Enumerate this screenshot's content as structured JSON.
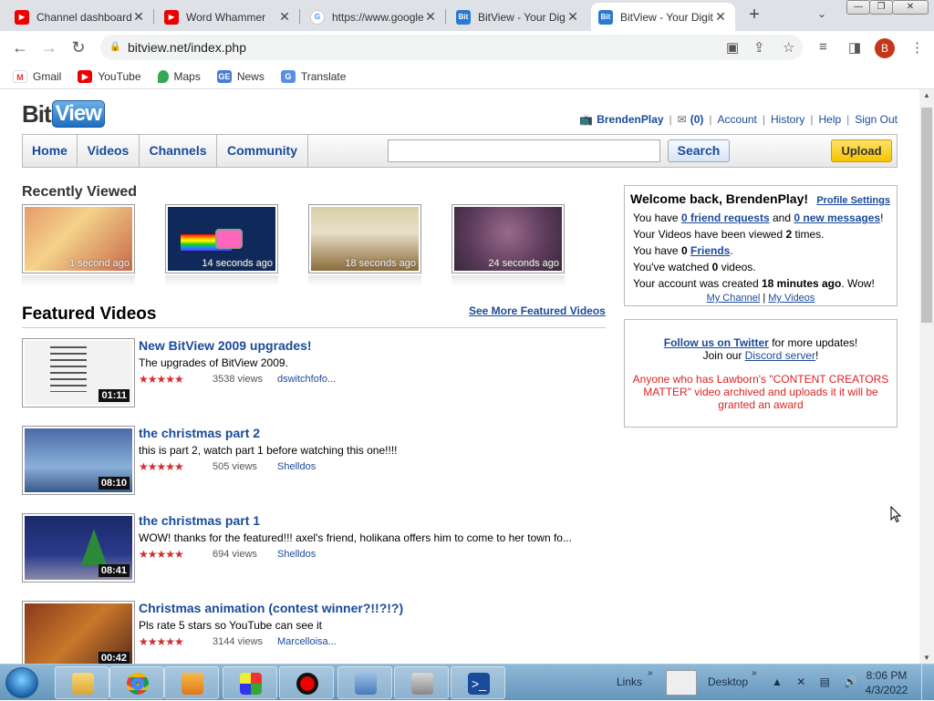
{
  "browser": {
    "tabs": [
      {
        "title": "Channel dashboard",
        "icon": "youtube-icon"
      },
      {
        "title": "Word Whammer",
        "icon": "youtube-icon"
      },
      {
        "title": "https://www.google",
        "icon": "google-icon"
      },
      {
        "title": "BitView - Your Digital",
        "icon": "bitview-icon"
      },
      {
        "title": "BitView - Your Digital",
        "icon": "bitview-icon"
      }
    ],
    "url": "bitview.net/index.php",
    "profile_initial": "B",
    "bookmarks": [
      {
        "label": "Gmail"
      },
      {
        "label": "YouTube"
      },
      {
        "label": "Maps"
      },
      {
        "label": "News"
      },
      {
        "label": "Translate"
      }
    ]
  },
  "site": {
    "logo_bit": "Bit",
    "logo_view": "View",
    "user": "BrendenPlay",
    "inbox_count": "(0)",
    "links": [
      "Account",
      "History",
      "Help",
      "Sign Out"
    ],
    "nav": [
      "Home",
      "Videos",
      "Channels",
      "Community"
    ],
    "search_value": "",
    "search_label": "Search",
    "upload_label": "Upload"
  },
  "recently_viewed": {
    "title": "Recently Viewed",
    "items": [
      {
        "ago": "1 second ago"
      },
      {
        "ago": "14 seconds ago"
      },
      {
        "ago": "18 seconds ago"
      },
      {
        "ago": "24 seconds ago"
      }
    ]
  },
  "featured": {
    "title": "Featured Videos",
    "more_label": "See More Featured Videos",
    "videos": [
      {
        "title": "New BitView 2009 upgrades!",
        "desc": "The upgrades of BitView 2009.",
        "views": "3538 views",
        "author": "dswitchfofo...",
        "duration": "01:11",
        "stars": "★★★★★"
      },
      {
        "title": "the christmas part 2",
        "desc": "this is part 2, watch part 1 before watching this one!!!!",
        "views": "505 views",
        "author": "Shelldos",
        "duration": "08:10",
        "stars": "★★★★★"
      },
      {
        "title": "the christmas part 1",
        "desc": "WOW! thanks for the featured!!! axel's friend, holikana offers him to come to her town fo...",
        "views": "694 views",
        "author": "Shelldos",
        "duration": "08:41",
        "stars": "★★★★★"
      },
      {
        "title": "Christmas animation (contest winner?!!?!?)",
        "desc": "Pls rate 5 stars so YouTube can see it",
        "views": "3144 views",
        "author": "Marcelloisa...",
        "duration": "00:42",
        "stars": "★★★★★"
      }
    ]
  },
  "welcome": {
    "title": "Welcome back, BrendenPlay!",
    "profile_settings": "Profile Settings",
    "l1_a": "You have ",
    "l1_link1": "0 friend requests",
    "l1_b": " and ",
    "l1_link2": "0 new messages",
    "l1_c": "!",
    "l2_a": "Your Videos have been viewed ",
    "l2_num": "2",
    "l2_b": " times.",
    "l3_a": "You have ",
    "l3_num": "0",
    "l3_sp": " ",
    "l3_link": "Friends",
    "l3_b": ".",
    "l4_a": "You've watched ",
    "l4_num": "0",
    "l4_b": " videos.",
    "l5_a": "Your account was created ",
    "l5_bold": "18 minutes ago",
    "l5_b": ". Wow!",
    "my_channel": "My Channel",
    "links_sep": " | ",
    "my_videos": "My Videos"
  },
  "notice": {
    "twitter_link": "Follow us on Twitter",
    "twitter_rest": " for more updates!",
    "discord_a": "Join our ",
    "discord_link": "Discord server",
    "discord_b": "!",
    "red_text": "Anyone who has Lawborn's \"CONTENT CREATORS MATTER\" video archived and uploads it it will be granted an award"
  },
  "taskbar": {
    "links_label": "Links",
    "desktop_label": "Desktop",
    "time": "8:06 PM",
    "date": "4/3/2022"
  },
  "colors": {
    "link": "#1a4a9a",
    "star": "#d12f2f",
    "notice_red": "#dd2222"
  }
}
